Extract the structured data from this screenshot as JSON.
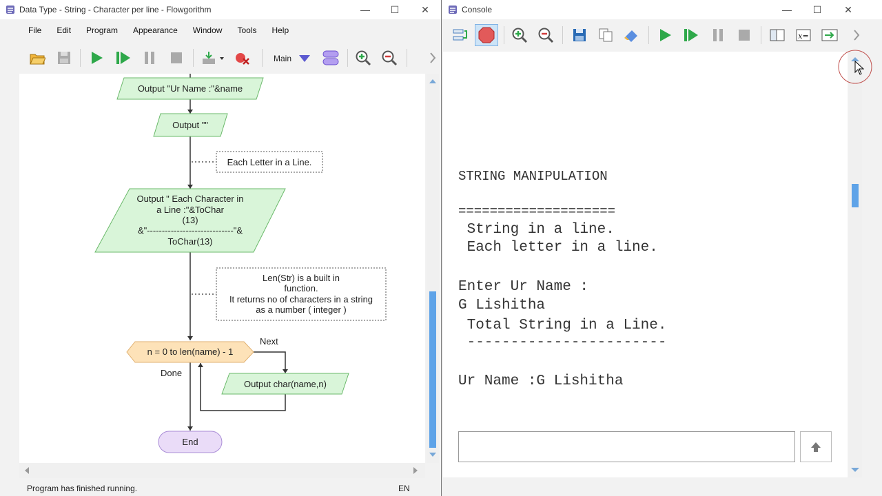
{
  "left_window": {
    "title": "Data Type - String - Character per line - Flowgorithm",
    "menu": [
      "File",
      "Edit",
      "Program",
      "Appearance",
      "Window",
      "Tools",
      "Help"
    ],
    "function_select": "Main",
    "status": "Program has finished running.",
    "language": "EN"
  },
  "flowchart": {
    "output_name": "Output \"Ur Name :\"&name",
    "output_empty": "Output \"\"",
    "comment1": "Each Letter in a Line.",
    "output_each": [
      "Output \" Each Character in",
      "a Line :\"&ToChar",
      "(13)",
      "&\"-----------------------------\"&",
      "ToChar(13)"
    ],
    "comment2": [
      "Len(Str) is a built in",
      "function.",
      "It returns no of characters in a string",
      "as a number ( integer )"
    ],
    "loop": "n = 0 to len(name) - 1",
    "next": "Next",
    "done": "Done",
    "output_char": "Output char(name,n)",
    "end": "End"
  },
  "right_window": {
    "title": "Console"
  },
  "console_lines": [
    "STRING MANIPULATION",
    "====================",
    " String in a line.",
    " Each letter in a line.",
    "Enter Ur Name :",
    "G Lishitha",
    " Total String in a Line.",
    " -----------------------",
    "Ur Name :G Lishitha"
  ],
  "colors": {
    "shape_fill": "#d9f5d9",
    "shape_stroke": "#6ab96a",
    "loop_fill": "#fde2b8",
    "end_fill": "#eadcf8",
    "play_green": "#2ea84a"
  }
}
